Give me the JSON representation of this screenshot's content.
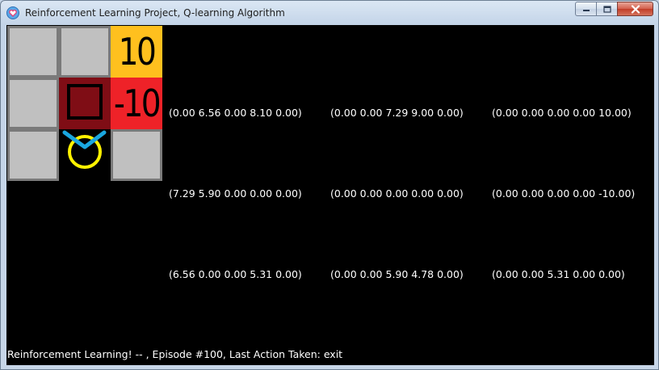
{
  "window": {
    "title": "Reinforcement Learning Project, Q-learning Algorithm",
    "buttons": [
      "minimize-button",
      "maximize-button",
      "close-button"
    ]
  },
  "grid": {
    "colors": {
      "grey_fill": "#c0c0c0",
      "grey_border": "#7a7a7a",
      "goal_positive": "#ffc01e",
      "goal_negative": "#ee2228",
      "wall": "#7f0d15",
      "agent_circle": "#fff200",
      "agent_arrow": "#1aa7e0"
    },
    "positive_reward": "10",
    "negative_reward": "-10"
  },
  "q_values": {
    "row1": [
      "(0.00 6.56 0.00 8.10 0.00)",
      "(0.00 0.00 7.29 9.00 0.00)",
      "(0.00 0.00 0.00 0.00 10.00)"
    ],
    "row2": [
      "(7.29 5.90 0.00 0.00 0.00)",
      "(0.00 0.00 0.00 0.00 0.00)",
      "(0.00 0.00 0.00 0.00 -10.00)"
    ],
    "row3": [
      "(6.56 0.00 0.00 5.31 0.00)",
      "(0.00 0.00 5.90 4.78 0.00)",
      "(0.00 0.00 5.31 0.00 0.00)"
    ]
  },
  "status_text": "Reinforcement Learning! -- , Episode #100, Last Action Taken: exit"
}
